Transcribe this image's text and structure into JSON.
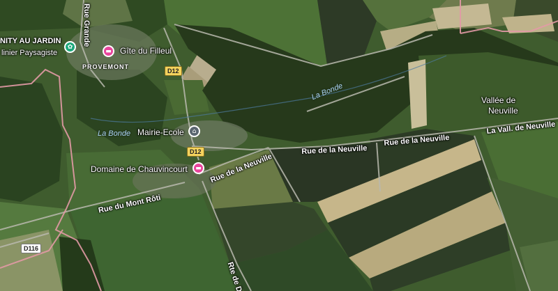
{
  "map": {
    "colors": {
      "forest": "#2f4a22",
      "field_light": "#cbbf95",
      "field_green": "#4e6e35",
      "field_dark": "#2c3b25",
      "boundary": "#e39aa6",
      "hotel_pin": "#e8459c",
      "civic_pin": "#5b6670",
      "garden_pin": "#1ea97c"
    },
    "places": {
      "garden": "NITY AU JARDIN",
      "garden_sub": "linier Paysagiste",
      "gite": "Gîte du Filleul",
      "village": "PROVEMONT",
      "mairie": "Mairie-Ecole",
      "domaine": "Domaine de Chauvincourt",
      "vallee_line1": "Vallée de",
      "vallee_line2": "Neuville"
    },
    "water": {
      "bonde_1": "La Bonde",
      "bonde_2": "La Bonde"
    },
    "roads": {
      "rue_grande": "Rue Grande",
      "neuville_1": "Rue de la Neuville",
      "neuville_2": "Rue de la Neuville",
      "neuville_3": "Rue de la Neuville",
      "vall_neuville": "La Vall. de Neuville",
      "mont_roti": "Rue du Mont Rôti",
      "rte_d": "Rte de D"
    },
    "shields": {
      "d12_a": "D12",
      "d12_b": "D12",
      "d116": "D116"
    },
    "icons": {
      "hotel": "hotel-icon",
      "civic": "town-hall-icon",
      "garden": "garden-icon"
    }
  }
}
